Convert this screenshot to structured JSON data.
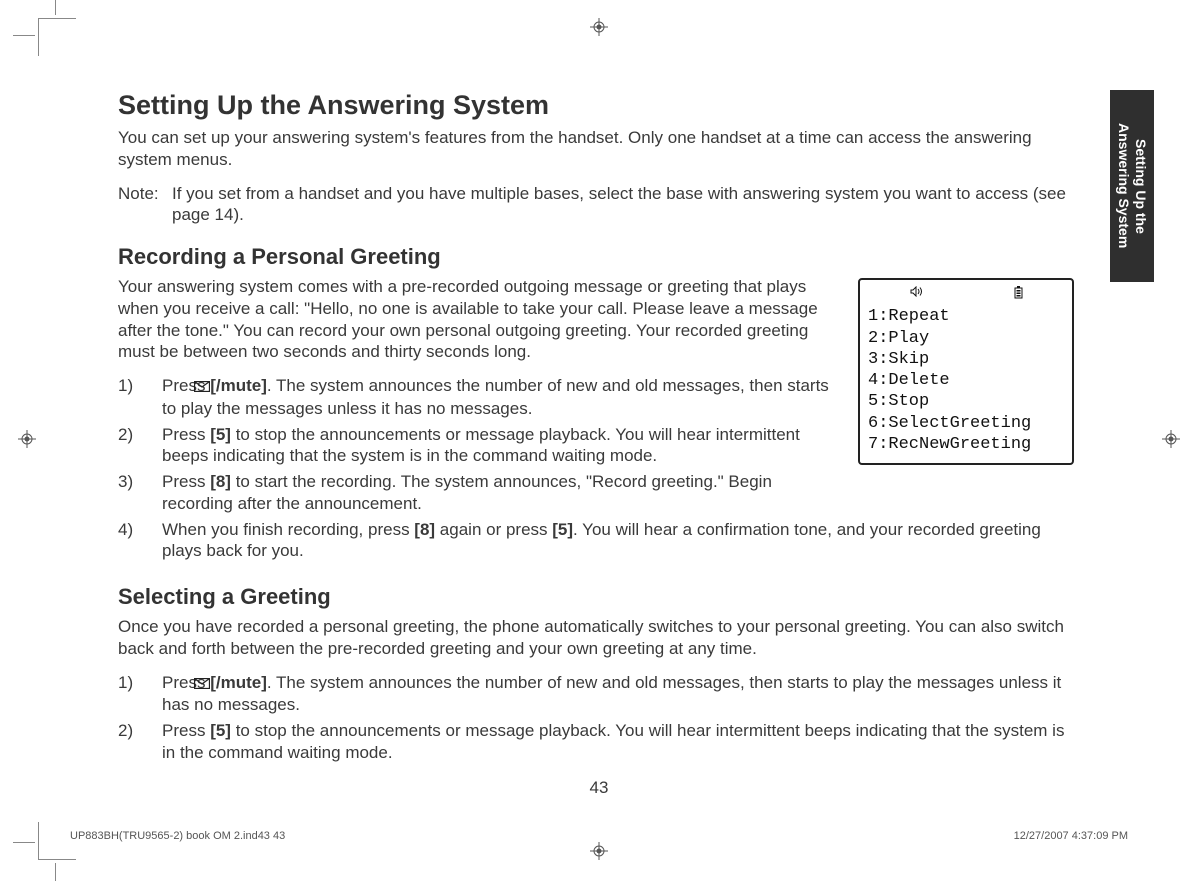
{
  "sideTab": {
    "line1": "Setting Up the",
    "line2": "Answering System"
  },
  "h1": "Setting Up the Answering System",
  "intro": "You can set up your answering system's features from the handset. Only one handset at a time can access the answering system menus.",
  "note": {
    "label": "Note:",
    "body": "If you set from a handset and you have multiple bases, select the base with answering system you want to access (see page 14)."
  },
  "sec1": {
    "title": "Recording a Personal Greeting",
    "para": "Your answering system comes with a pre-recorded outgoing message or greeting that plays when you receive a call: \"Hello, no one is available to take your call. Please leave a message after the tone.\" You can record your own personal outgoing greeting. Your recorded greeting must be between two seconds and thirty seconds long.",
    "step1_a": "Press ",
    "step1_b": "[",
    "step1_c": "/mute]",
    "step1_d": ". The system announces the number of new and old messages, then starts to play the messages unless it has no messages.",
    "step2_a": "Press ",
    "step2_b": "[5]",
    "step2_c": " to stop the announcements or message playback. You will hear intermittent beeps indicating that the system is in the command waiting mode.",
    "step3_a": "Press ",
    "step3_b": "[8]",
    "step3_c": " to start the recording. The system announces, \"Record greeting.\" Begin recording after the announcement.",
    "step4_a": "When you finish recording, press ",
    "step4_b": "[8]",
    "step4_c": " again or press ",
    "step4_d": "[5]",
    "step4_e": ". You will hear a confirmation tone, and your recorded greeting plays back for you."
  },
  "screen": {
    "lines": [
      "1:Repeat",
      "2:Play",
      "3:Skip",
      "4:Delete",
      "5:Stop",
      "6:SelectGreeting",
      "7:RecNewGreeting"
    ]
  },
  "sec2": {
    "title": "Selecting a Greeting",
    "para": "Once you have recorded a personal greeting, the phone automatically switches to your personal greeting. You can also switch back and forth between the pre-recorded greeting and your own greeting at any time.",
    "step1_a": "Press ",
    "step1_b": "[",
    "step1_c": "/mute]",
    "step1_d": ". The system announces the number of new and old messages, then starts to play the messages unless it has no messages.",
    "step2_a": "Press ",
    "step2_b": "[5]",
    "step2_c": " to stop the announcements or message playback. You will hear intermittent beeps indicating that the system is in the command waiting mode."
  },
  "pageNumber": "43",
  "footer": {
    "left": "UP883BH(TRU9565-2) book OM 2.ind43   43",
    "right": "12/27/2007   4:37:09 PM"
  }
}
